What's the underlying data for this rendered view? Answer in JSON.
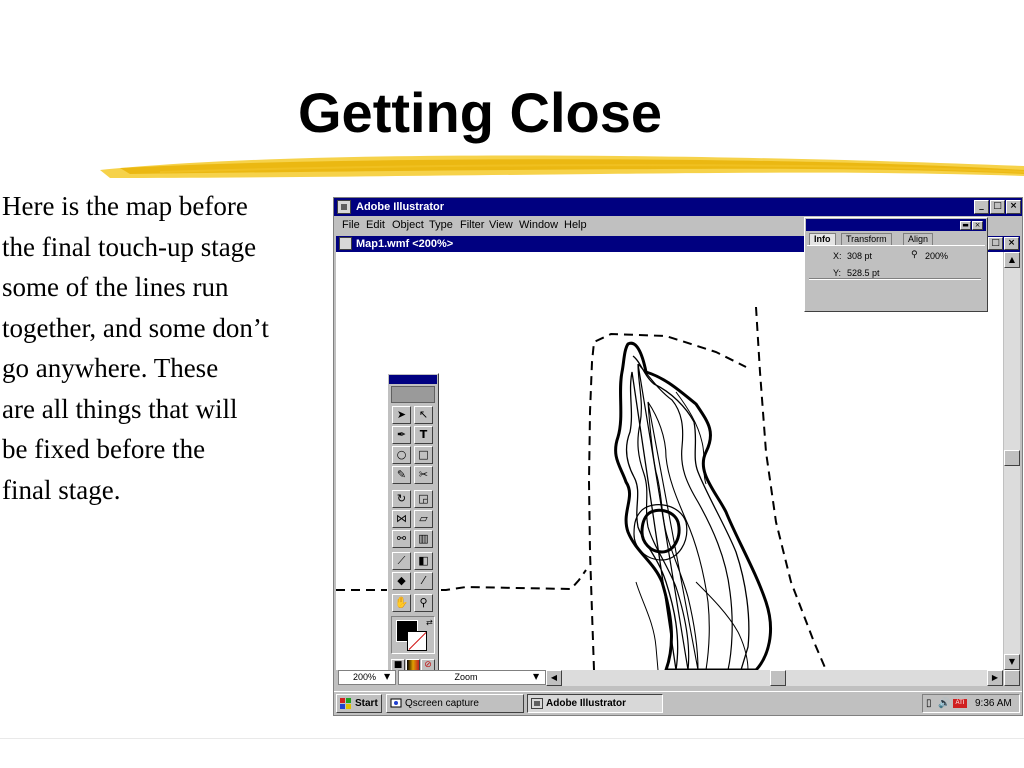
{
  "slide": {
    "title": "Getting Close",
    "body": "  Here is the map before\nthe final touch-up stage\nsome of the lines run\ntogether, and some don’t\ngo anywhere.  These\nare all things that will\nbe fixed before the\nfinal stage.",
    "accent_color": "#f2c318"
  },
  "app": {
    "title": "Adobe Illustrator",
    "caption_buttons": [
      "_",
      "□",
      "×"
    ],
    "menu": [
      "File",
      "Edit",
      "Object",
      "Type",
      "Filter",
      "View",
      "Window",
      "Help"
    ]
  },
  "document": {
    "title": "Map1.wmf <200%>",
    "buttons": [
      "_",
      "□",
      "×"
    ]
  },
  "status_bar": {
    "zoom": "200%",
    "mode": "Zoom"
  },
  "info_palette": {
    "tabs": [
      "Info",
      "Transform",
      "Align"
    ],
    "active_tab": "Info",
    "x_label": "X:",
    "x_value": "308 pt",
    "y_label": "Y:",
    "y_value": "528.5 pt",
    "zoom_value": "200%"
  },
  "toolbox": {
    "tools": [
      "selection-tool",
      "direct-selection-tool",
      "pen-tool",
      "type-tool",
      "ellipse-tool",
      "rectangle-tool",
      "pencil-tool",
      "scissors-tool",
      "rotate-tool",
      "scale-tool",
      "reflect-tool",
      "shear-tool",
      "blend-tool",
      "graph-tool",
      "measure-tool",
      "gradient-tool",
      "paint-bucket-tool",
      "eyedropper-tool",
      "hand-tool",
      "zoom-tool"
    ]
  },
  "taskbar": {
    "start_label": "Start",
    "tasks": [
      "Qscreen capture",
      "Adobe Illustrator"
    ],
    "active_task": "Adobe Illustrator",
    "clock": "9:36 AM"
  }
}
